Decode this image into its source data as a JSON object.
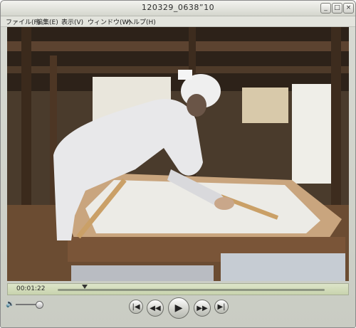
{
  "window": {
    "title": "120329_0638”10"
  },
  "window_buttons": {
    "minimize": "_",
    "maximize": "□",
    "close": "×"
  },
  "menu": [
    {
      "label": "ファイル(F)"
    },
    {
      "label": "編集(E)"
    },
    {
      "label": "表示(V)"
    },
    {
      "label": "ウィンドウ(W)"
    },
    {
      "label": "ヘルプ(H)"
    }
  ],
  "player": {
    "current_time": "00:01:22",
    "icons": {
      "volume": "speaker-icon",
      "go_to_start": "skip-to-start-icon",
      "rewind": "rewind-icon",
      "play": "play-icon",
      "fast_forward": "fast-forward-icon",
      "go_to_end": "skip-to-end-icon"
    },
    "glyphs": {
      "volume": "🔉",
      "go_to_start": "|◀",
      "rewind": "◀◀",
      "play": "▶",
      "fast_forward": "▶▶",
      "go_to_end": "▶|"
    }
  },
  "colors": {
    "timebar": "#d2dbb8",
    "chrome": "#d0d2ca"
  }
}
